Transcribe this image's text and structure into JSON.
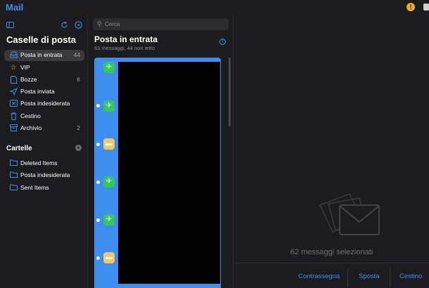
{
  "app": {
    "title": "Mail"
  },
  "sidebar": {
    "title": "Caselle di posta",
    "mailboxes": [
      {
        "label": "Posta in entrata",
        "count": "44",
        "icon": "inbox-icon"
      },
      {
        "label": "VIP",
        "count": "",
        "icon": "star-icon"
      },
      {
        "label": "Bozze",
        "count": "6",
        "icon": "draft-icon"
      },
      {
        "label": "Posta inviata",
        "count": "",
        "icon": "paperplane-icon"
      },
      {
        "label": "Posta indesiderata",
        "count": "",
        "icon": "junk-icon"
      },
      {
        "label": "Cestino",
        "count": "",
        "icon": "trash-icon"
      },
      {
        "label": "Archivio",
        "count": "2",
        "icon": "archive-icon"
      }
    ],
    "folders_title": "Cartelle",
    "folders": [
      {
        "label": "Deleted Items",
        "icon": "folder-icon"
      },
      {
        "label": "Posta indesiderata",
        "icon": "folder-icon"
      },
      {
        "label": "Sent Items",
        "icon": "folder-icon"
      }
    ]
  },
  "list": {
    "search_placeholder": "Cerca",
    "title": "Posta in entrata",
    "subtitle": "63 messaggi, 44 non letto"
  },
  "detail": {
    "selection_text": "62 messaggi selezionati",
    "actions": [
      "Contrassegna",
      "Sposta",
      "Cestino"
    ]
  },
  "colors": {
    "accent": "#3b8ff6",
    "selection": "#3d8ef0",
    "travel": "#34c759",
    "transaction": "#f7c85a"
  }
}
